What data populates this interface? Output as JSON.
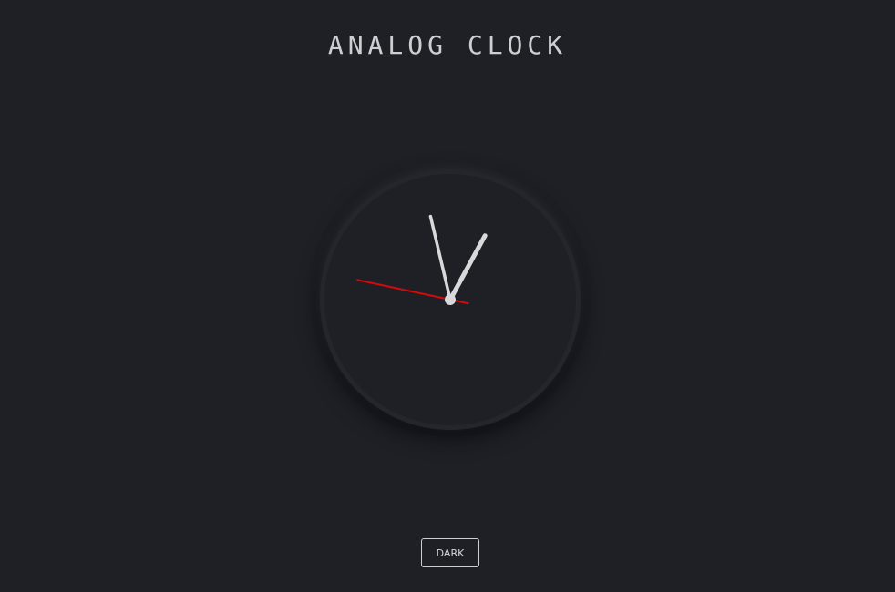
{
  "page": {
    "title": "ANALOG CLOCK"
  },
  "clock": {
    "time": {
      "hour": 12,
      "minute": 57,
      "second": 47
    },
    "colors": {
      "face": "#1f2026",
      "hour_hand": "#d9d9db",
      "minute_hand": "#d9d9db",
      "second_hand": "#d10a0a",
      "center_cap": "#d9d9db"
    },
    "icons": {
      "center": "pivot-cap-icon"
    }
  },
  "theme_toggle": {
    "label": "DARK"
  }
}
